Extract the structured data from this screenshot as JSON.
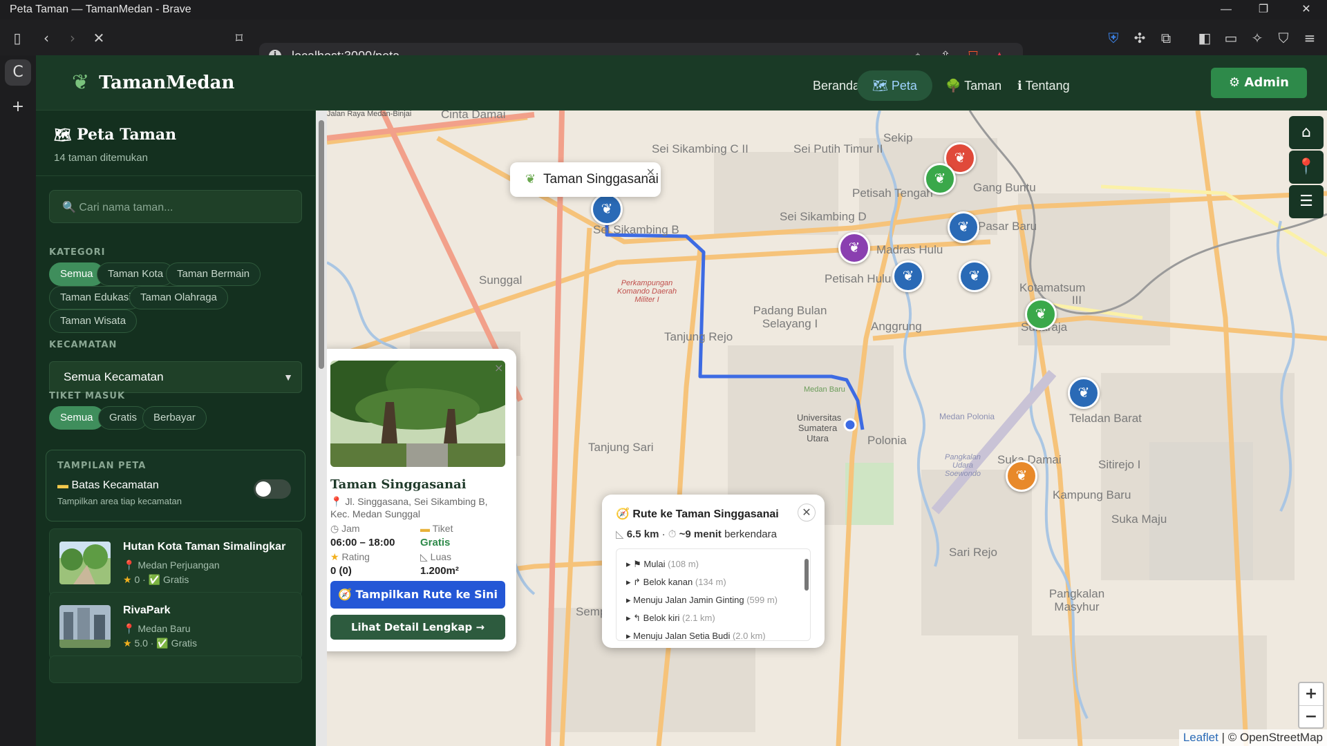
{
  "window": {
    "title": "Peta Taman — TamanMedan - Brave",
    "min": "—",
    "max": "❐",
    "close": "✕"
  },
  "browser": {
    "url": "localhost:3000/peta"
  },
  "app": {
    "brand": "TamanMedan",
    "nav": [
      "Beranda",
      "Peta",
      "Taman",
      "Tentang"
    ],
    "nav_icons": [
      "",
      "🗺",
      "🌳",
      "ℹ"
    ],
    "admin": "Admin"
  },
  "sidebar": {
    "title": "Peta Taman",
    "count": "14 taman ditemukan",
    "search_placeholder": "Cari nama taman...",
    "category_label": "KATEGORI",
    "categories": [
      "Semua",
      "Taman Kota",
      "Taman Bermain",
      "Taman Edukasi",
      "Taman Olahraga",
      "Taman Wisata"
    ],
    "district_label": "KECAMATAN",
    "district_value": "Semua Kecamatan",
    "ticket_label": "TIKET MASUK",
    "tickets": [
      "Semua",
      "Gratis",
      "Berbayar"
    ],
    "map_view_label": "TAMPILAN PETA",
    "toggle_title": "Batas Kecamatan",
    "toggle_sub": "Tampilkan area tiap kecamatan",
    "parks": [
      {
        "name": "Hutan Kota Taman Simalingkar",
        "location": "Medan Perjuangan",
        "meta": "0 · ✅ Gratis"
      },
      {
        "name": "RivaPark",
        "location": "Medan Baru",
        "meta": "5.0 · ✅ Gratis"
      }
    ]
  },
  "map": {
    "labels": [
      "Jalan Raya Medan-Binjai",
      "Cinta Damai",
      "Sei Sikambing C II",
      "Sei Putih Timur II",
      "Sekip",
      "Petisah Tengah",
      "Gang Buntu",
      "Sei Sikambing D",
      "Madras Hulu",
      "Pasar Baru",
      "Sunggal",
      "Petisah Hulu",
      "Padang Bulan Selayang I",
      "Tanjung Rejo",
      "Anggrung",
      "Sukaraja",
      "Kotamatsum III",
      "Medan Baru",
      "Universitas Sumatera Utara",
      "Polonia",
      "Tanjung Sari",
      "Medan Polonia",
      "Teladan Barat",
      "Suka Damai",
      "Sitirejo I",
      "Kampung Baru",
      "Sari Rejo",
      "Suka Maju",
      "Pangkalan Masyhur",
      "Sempakata",
      "Sei Sikambing B",
      "Perkampungan Komando Daerah Militer I",
      "Pangkalan Udara Soewondo"
    ],
    "tooltip": "Taman Singgasanai",
    "popup": {
      "name": "Taman Singgasanai",
      "address": "Jl. Singgasana, Sei Sikambing B, Kec. Medan Sunggal",
      "jam_label": "Jam",
      "jam": "06:00 – 18:00",
      "tiket_label": "Tiket",
      "tiket": "Gratis",
      "rating_label": "Rating",
      "rating": "0 (0)",
      "luas_label": "Luas",
      "luas": "1.200m²",
      "route_btn": "Tampilkan Rute ke Sini",
      "detail_btn": "Lihat Detail Lengkap →"
    },
    "route": {
      "title": "Rute ke Taman Singgasanai",
      "distance": "6.5 km",
      "duration": "~9 menit",
      "duration_suffix": "berkendara",
      "steps": [
        {
          "text": "Mulai",
          "dist": "(108 m)"
        },
        {
          "text": "Belok kanan",
          "dist": "(134 m)"
        },
        {
          "text": "Menuju Jalan Jamin Ginting",
          "dist": "(599 m)"
        },
        {
          "text": "Belok kiri",
          "dist": "(2.1 km)"
        },
        {
          "text": "Menuju Jalan Setia Budi",
          "dist": "(2.0 km)"
        }
      ]
    },
    "zoom_in": "+",
    "zoom_out": "−",
    "attribution_leaflet": "Leaflet",
    "attribution_osm": "| © OpenStreetMap"
  }
}
